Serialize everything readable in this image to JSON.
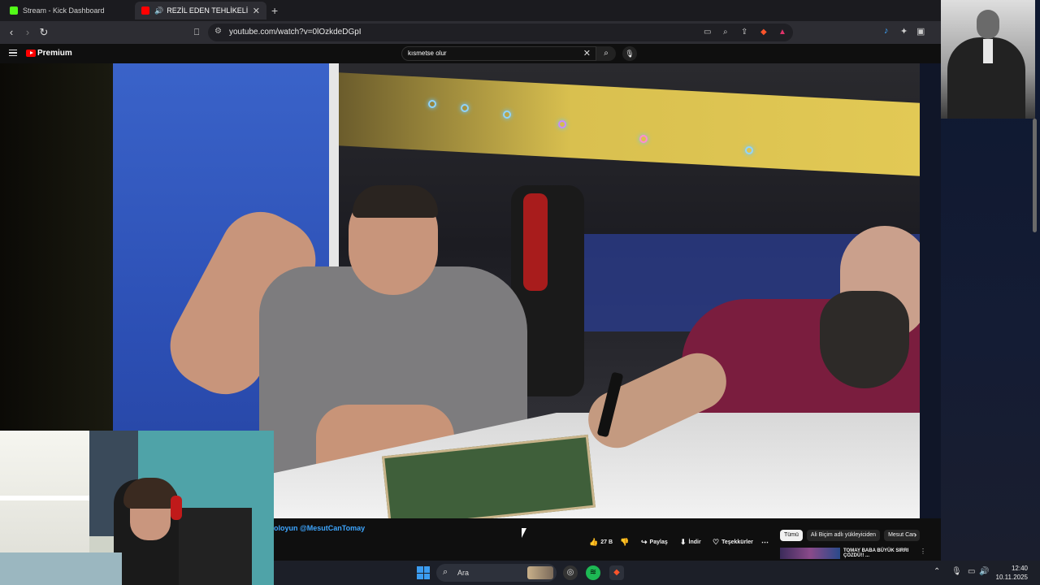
{
  "browser": {
    "tabs": [
      {
        "title": "Stream - Kick Dashboard",
        "active": false,
        "icon": "kick-icon"
      },
      {
        "title": "REZİL EDEN TEHLİKELİ MASAJ",
        "active": true,
        "icon": "youtube-icon"
      }
    ],
    "url": "youtube.com/watch?v=0lOzkdeDGpI"
  },
  "youtube": {
    "logo_label": "Premium",
    "search_query": "kısmetse olur"
  },
  "video": {
    "subscribe_text": "oloyun @MesutCanTomay"
  },
  "actions": {
    "like_count": "27 B",
    "share": "Paylaş",
    "download": "İndir",
    "thanks": "Teşekkürler"
  },
  "chips": [
    "Tümü",
    "Ali Biçim adlı yükleyiciden",
    "Mesut Can"
  ],
  "recommendation": {
    "title": "TOMAY BABA BÜYÜK SIRRI ÇÖZDÜ!! ..."
  },
  "taskbar": {
    "search_label": "Ara",
    "time": "12:40",
    "date": "10.11.2025"
  },
  "colors": {
    "youtube_red": "#ff0000",
    "link_blue": "#3ea6ff",
    "windows_blue": "#3b9cf0",
    "spotify_green": "#1db954",
    "brave_orange": "#fb542b"
  }
}
